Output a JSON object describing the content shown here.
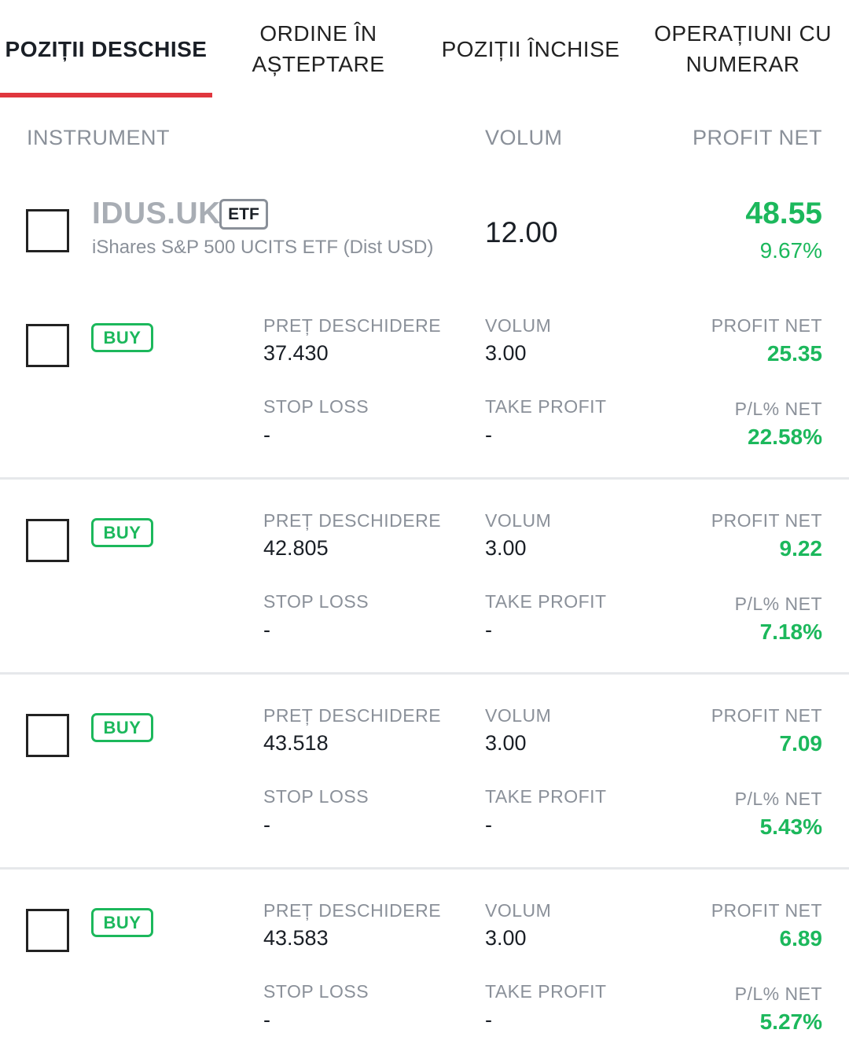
{
  "tabs": [
    {
      "label": "POZIȚII DESCHISE",
      "active": true
    },
    {
      "label": "ORDINE ÎN\nAȘTEPTARE",
      "active": false
    },
    {
      "label": "POZIȚII ÎNCHISE",
      "active": false
    },
    {
      "label": "OPERAȚIUNI CU\nNUMERAR",
      "active": false
    }
  ],
  "columns": {
    "instrument": "INSTRUMENT",
    "volume": "VOLUM",
    "profit": "PROFIT NET"
  },
  "instrument": {
    "symbol": "IDUS.UK",
    "badge": "ETF",
    "description": "iShares S&P 500 UCITS ETF (Dist USD)",
    "volume": "12.00",
    "profit": "48.55",
    "profit_pct": "9.67%"
  },
  "labels": {
    "open_price": "PREȚ DESCHIDERE",
    "volume": "VOLUM",
    "profit": "PROFIT NET",
    "stop_loss": "STOP LOSS",
    "take_profit": "TAKE PROFIT",
    "pl_pct": "P/L% NET"
  },
  "positions": [
    {
      "side": "BUY",
      "open_price": "37.430",
      "volume": "3.00",
      "profit": "25.35",
      "stop_loss": "-",
      "take_profit": "-",
      "pl_pct": "22.58%"
    },
    {
      "side": "BUY",
      "open_price": "42.805",
      "volume": "3.00",
      "profit": "9.22",
      "stop_loss": "-",
      "take_profit": "-",
      "pl_pct": "7.18%"
    },
    {
      "side": "BUY",
      "open_price": "43.518",
      "volume": "3.00",
      "profit": "7.09",
      "stop_loss": "-",
      "take_profit": "-",
      "pl_pct": "5.43%"
    },
    {
      "side": "BUY",
      "open_price": "43.583",
      "volume": "3.00",
      "profit": "6.89",
      "stop_loss": "-",
      "take_profit": "-",
      "pl_pct": "5.27%"
    }
  ],
  "colors": {
    "accent": "#e0363e",
    "positive": "#1cb85c",
    "muted": "#8a9099"
  }
}
